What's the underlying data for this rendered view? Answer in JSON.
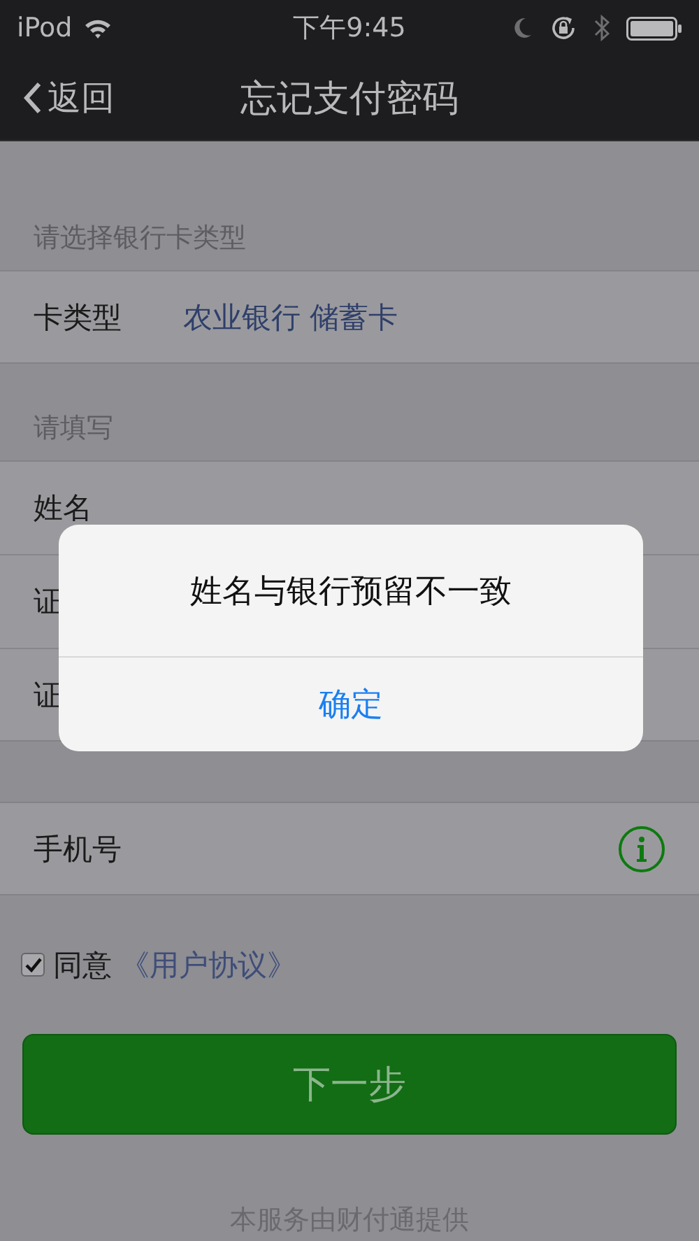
{
  "status_bar": {
    "carrier": "iPod",
    "time": "下午9:45"
  },
  "nav_bar": {
    "back": "返回",
    "title": "忘记支付密码"
  },
  "sections": [
    {
      "header": "请选择银行卡类型",
      "rows": [
        {
          "kind": "select",
          "label": "卡类型",
          "value": "农业银行 储蓄卡"
        }
      ]
    },
    {
      "header": "请填写",
      "rows": [
        {
          "kind": "input",
          "label": "姓名"
        },
        {
          "kind": "input",
          "label": "证"
        },
        {
          "kind": "input",
          "label": "证"
        }
      ]
    },
    {
      "rows": [
        {
          "kind": "info",
          "label": "手机号"
        }
      ]
    }
  ],
  "agreement": {
    "checked": true,
    "text": "同意",
    "link": "《用户协议》"
  },
  "next_button": "下一步",
  "footer": "本服务由财付通提供",
  "alert": {
    "message": "姓名与银行预留不一致",
    "button": "确定"
  }
}
